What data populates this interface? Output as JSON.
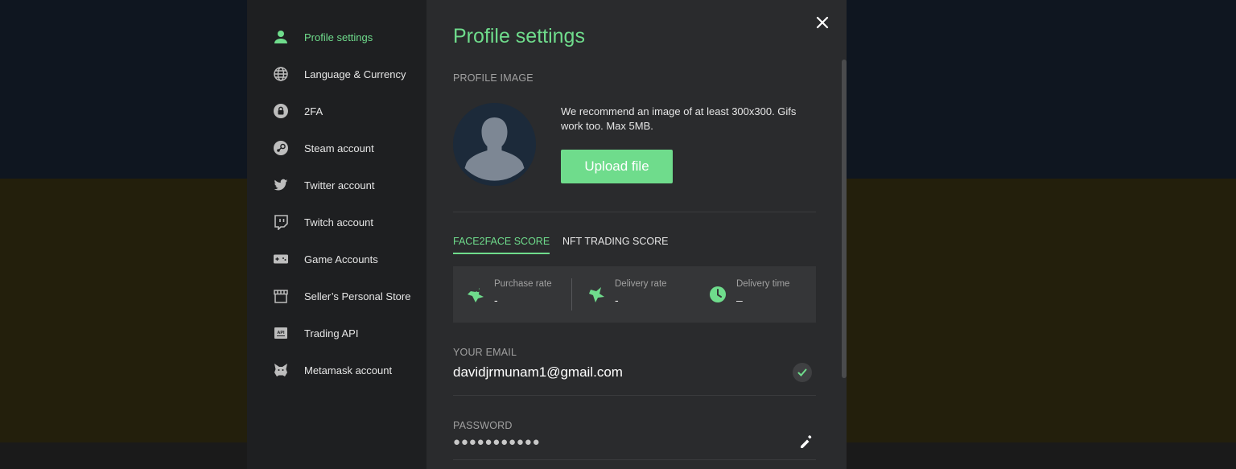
{
  "sidebar": {
    "items": [
      {
        "label": "Profile settings",
        "icon": "user-icon",
        "active": true
      },
      {
        "label": "Language & Currency",
        "icon": "globe-icon"
      },
      {
        "label": "2FA",
        "icon": "lock-icon"
      },
      {
        "label": "Steam account",
        "icon": "steam-icon"
      },
      {
        "label": "Twitter account",
        "icon": "twitter-icon"
      },
      {
        "label": "Twitch account",
        "icon": "twitch-icon"
      },
      {
        "label": "Game Accounts",
        "icon": "gamepad-icon"
      },
      {
        "label": "Seller’s Personal Store",
        "icon": "store-icon"
      },
      {
        "label": "Trading API",
        "icon": "api-icon"
      },
      {
        "label": "Metamask account",
        "icon": "fox-icon"
      }
    ]
  },
  "main": {
    "title": "Profile settings",
    "profile_image_label": "PROFILE IMAGE",
    "recommendation": "We recommend an image of at least 300x300. Gifs work too. Max 5MB.",
    "upload_label": "Upload file",
    "tabs": [
      {
        "label": "FACE2FACE SCORE",
        "active": true
      },
      {
        "label": "NFT TRADING SCORE",
        "active": false
      }
    ],
    "scores": [
      {
        "title": "Purchase rate",
        "value": "-"
      },
      {
        "title": "Delivery rate",
        "value": "-"
      },
      {
        "title": "Delivery time",
        "value": "–"
      }
    ],
    "email_label": "YOUR EMAIL",
    "email_value": "davidjrmunam1@gmail.com",
    "password_label": "PASSWORD",
    "password_value": "●●●●●●●●●●●"
  },
  "colors": {
    "accent": "#6fdc8c",
    "sidebar_bg": "#1e1f21",
    "content_bg": "#2a2b2d",
    "panel_bg": "#353638"
  }
}
